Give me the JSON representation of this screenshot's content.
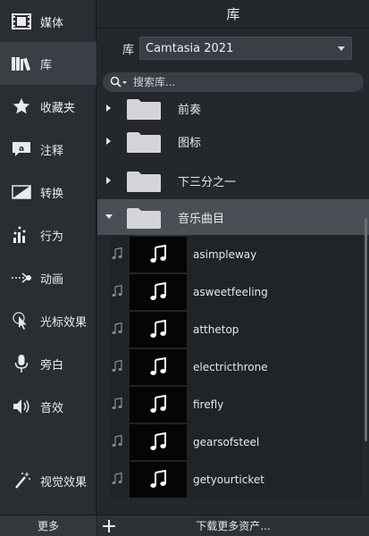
{
  "sidebar": {
    "items": [
      {
        "label": "媒体",
        "icon": "film-icon"
      },
      {
        "label": "库",
        "icon": "library-icon"
      },
      {
        "label": "收藏夹",
        "icon": "star-icon"
      },
      {
        "label": "注释",
        "icon": "annotation-icon"
      },
      {
        "label": "转换",
        "icon": "transition-icon"
      },
      {
        "label": "行为",
        "icon": "behavior-icon"
      },
      {
        "label": "动画",
        "icon": "animation-icon"
      },
      {
        "label": "光标效果",
        "icon": "cursor-icon"
      },
      {
        "label": "旁白",
        "icon": "microphone-icon"
      },
      {
        "label": "音效",
        "icon": "speaker-icon"
      },
      {
        "label": "视觉效果",
        "icon": "magic-wand-icon"
      }
    ],
    "more_label": "更多"
  },
  "panel": {
    "title": "库",
    "library_label": "库",
    "library_selected": "Camtasia 2021",
    "search_placeholder": "搜索库..."
  },
  "folders": [
    {
      "name": "前奏",
      "expanded": false
    },
    {
      "name": "图标",
      "expanded": false
    },
    {
      "name": "下三分之一",
      "expanded": false
    },
    {
      "name": "音乐曲目",
      "expanded": true
    }
  ],
  "tracks": [
    {
      "name": "asimpleway"
    },
    {
      "name": "asweetfeeling"
    },
    {
      "name": "atthetop"
    },
    {
      "name": "electricthrone"
    },
    {
      "name": "firefly"
    },
    {
      "name": "gearsofsteel"
    },
    {
      "name": "getyourticket"
    }
  ],
  "bottom": {
    "download_label": "下载更多资产..."
  },
  "colors": {
    "background": "#24282c",
    "sidebar": "#2a2e33",
    "active": "#3a3f45",
    "expanded_row": "#4a4f55"
  }
}
